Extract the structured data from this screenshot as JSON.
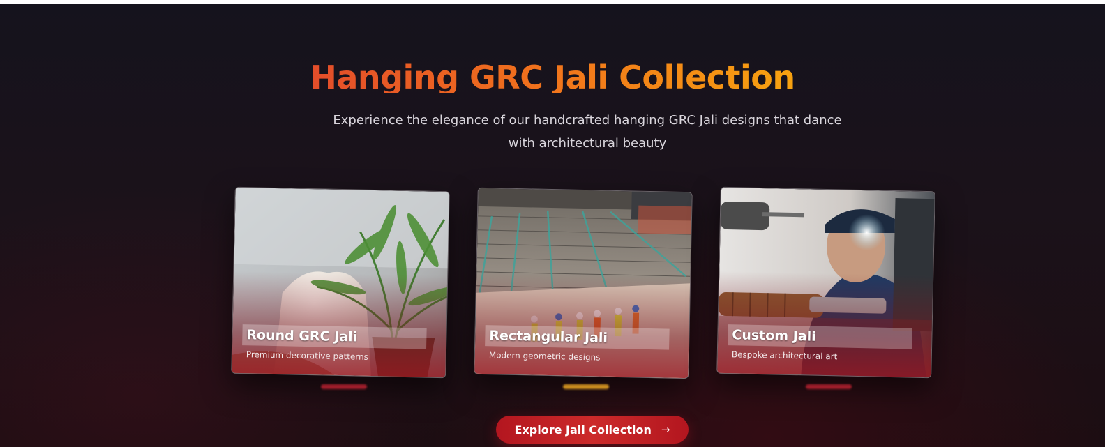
{
  "section": {
    "title": "Hanging GRC Jali Collection",
    "subtitle": "Experience the elegance of our handcrafted hanging GRC Jali designs that dance with architectural beauty"
  },
  "cards": [
    {
      "title": "Round GRC Jali",
      "description": "Premium decorative patterns",
      "image": "potted-palm-and-vase-photo"
    },
    {
      "title": "Rectangular Jali",
      "description": "Modern geometric designs",
      "image": "construction-site-workers-photo"
    },
    {
      "title": "Custom Jali",
      "description": "Bespoke architectural art",
      "image": "craftsman-at-lathe-photo"
    }
  ],
  "cta": {
    "label": "Explore Jali Collection",
    "icon": "arrow-right-icon"
  },
  "colors": {
    "title_gradient_start": "#e34d2a",
    "title_gradient_end": "#f7a210",
    "accent_red": "#c0202a",
    "accent_gold": "#c78a1f",
    "background": "#17121a"
  }
}
